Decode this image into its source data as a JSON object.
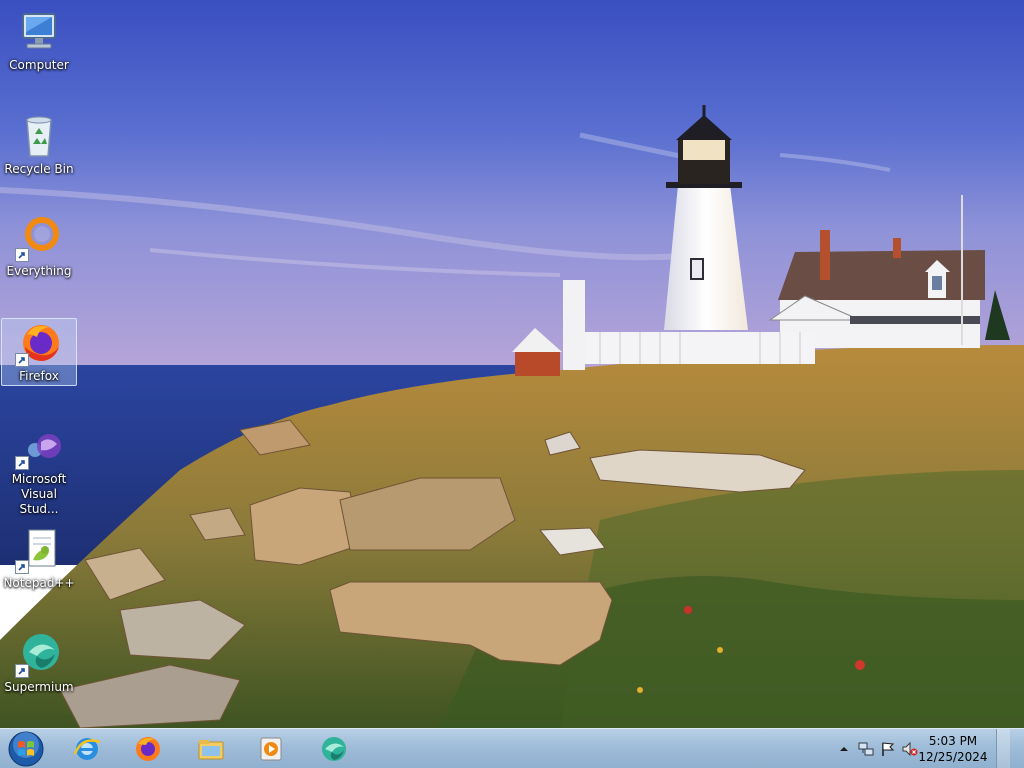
{
  "desktop": {
    "icons": [
      {
        "label": "Computer",
        "icon": "computer-icon",
        "shortcut": false
      },
      {
        "label": "Recycle Bin",
        "icon": "recycle-bin-icon",
        "shortcut": false
      },
      {
        "label": "Everything",
        "icon": "everything-search-icon",
        "shortcut": true
      },
      {
        "label": "Firefox",
        "icon": "firefox-icon",
        "shortcut": true,
        "selected": true
      },
      {
        "label": "Microsoft Visual Stud...",
        "icon": "visual-studio-icon",
        "shortcut": true
      },
      {
        "label": "Notepad++",
        "icon": "notepad-plus-plus-icon",
        "shortcut": true
      },
      {
        "label": "Supermium",
        "icon": "supermium-icon",
        "shortcut": true
      }
    ],
    "wallpaper": "lighthouse-coast"
  },
  "taskbar": {
    "start": "windows-start-orb-icon",
    "pinned": [
      {
        "name": "internet-explorer",
        "icon": "internet-explorer-icon"
      },
      {
        "name": "firefox",
        "icon": "firefox-icon"
      },
      {
        "name": "file-explorer",
        "icon": "folder-icon"
      },
      {
        "name": "media-player",
        "icon": "media-player-icon"
      },
      {
        "name": "supermium",
        "icon": "supermium-icon"
      }
    ],
    "tray": {
      "icons": [
        "show-hidden-icons-chevron",
        "network-icon",
        "action-center-flag-icon",
        "volume-muted-icon"
      ],
      "time": "5:03 PM",
      "date": "12/25/2024"
    }
  },
  "colors": {
    "taskbar": "#9fbcd8",
    "sky_top": "#3f56c4",
    "sea": "#2a3f8a",
    "selection": "#bed7f5"
  }
}
